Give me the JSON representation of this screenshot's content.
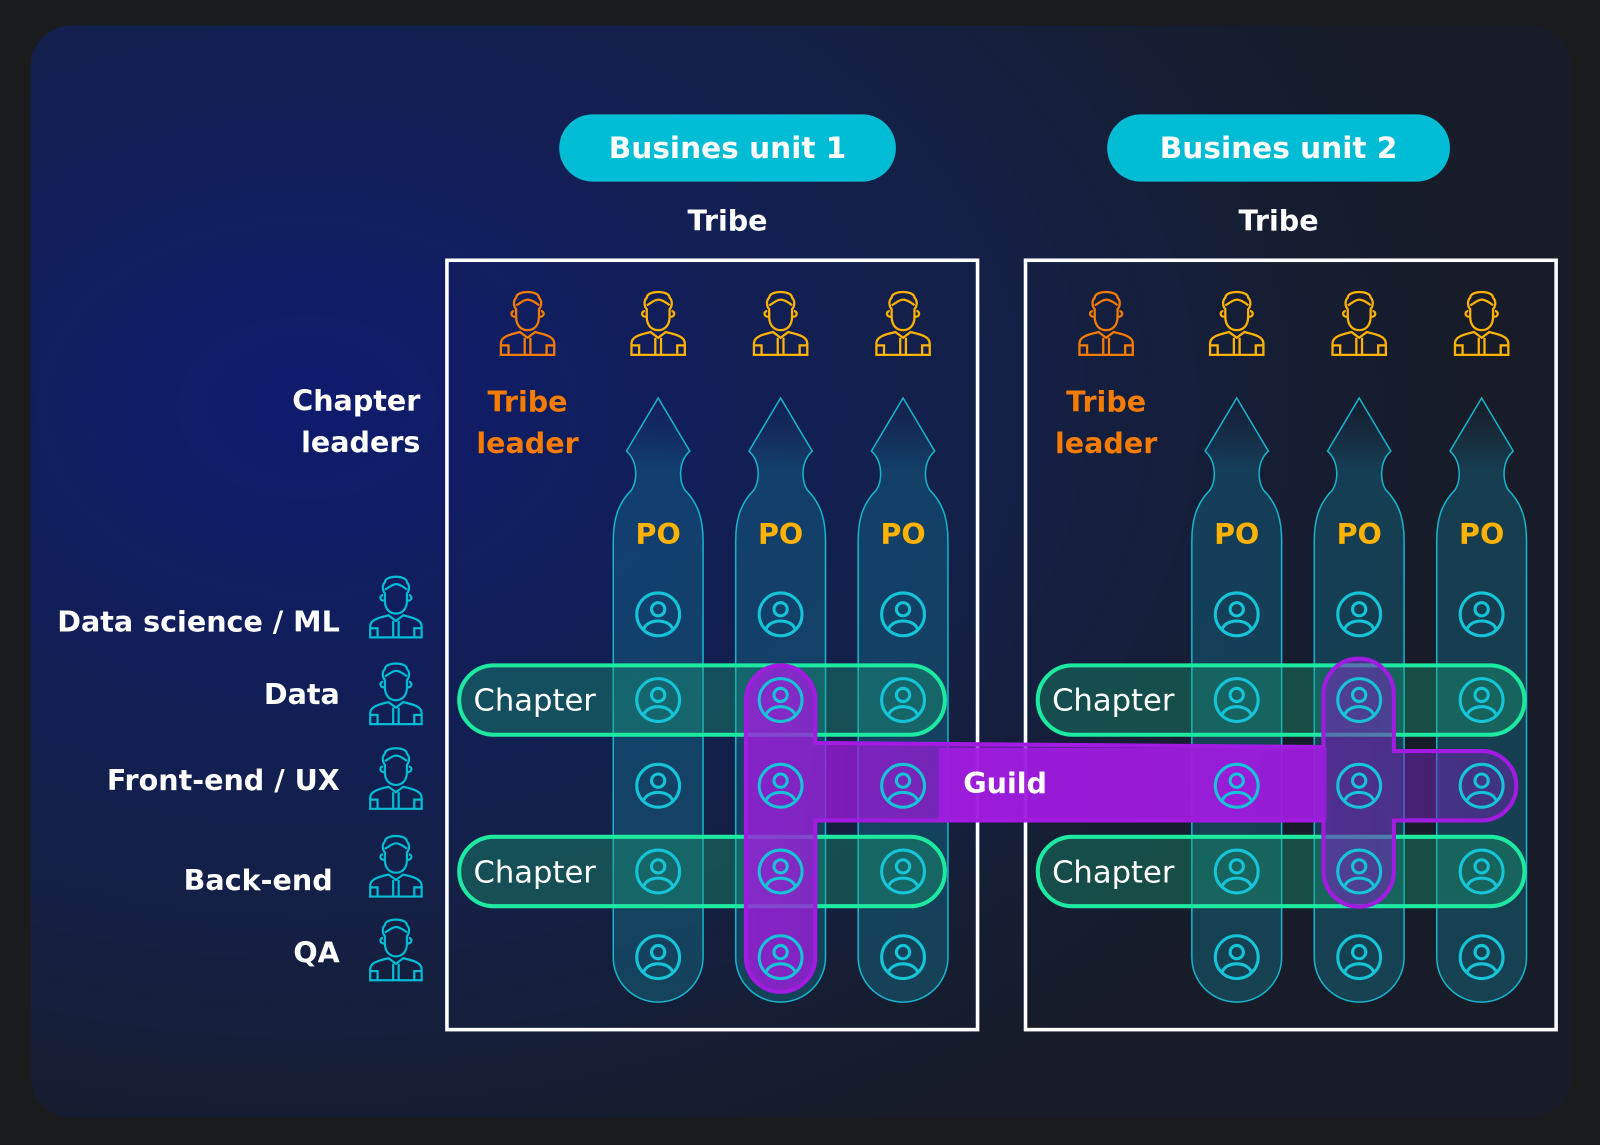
{
  "colors": {
    "background": "#1a1b1d",
    "background_glow": "#0f1a5c",
    "accent_cyan": "#00bcd4",
    "tribe_leader_orange": "#f57c00",
    "po_yellow": "#ffb300",
    "chapter_green": "#1de9a0",
    "guild_purple": "#a020e0",
    "box_border": "#ffffff"
  },
  "business_units": [
    {
      "label": "Busines unit 1",
      "tribe_label": "Tribe",
      "tribe_leader_label_line1": "Tribe",
      "tribe_leader_label_line2": "leader",
      "po_labels": [
        "PO",
        "PO",
        "PO"
      ],
      "chapter_labels": [
        "Chapter",
        "Chapter"
      ]
    },
    {
      "label": "Busines unit 2",
      "tribe_label": "Tribe",
      "tribe_leader_label_line1": "Tribe",
      "tribe_leader_label_line2": "leader",
      "po_labels": [
        "PO",
        "PO",
        "PO"
      ],
      "chapter_labels": [
        "Chapter",
        "Chapter"
      ]
    }
  ],
  "chapter_leaders": {
    "line1": "Chapter",
    "line2": "leaders"
  },
  "roles": [
    {
      "label": "Data science / ML",
      "icon": "man-shirt-icon"
    },
    {
      "label": "Data",
      "icon": "woman-icon"
    },
    {
      "label": "Front-end / UX",
      "icon": "man-icon"
    },
    {
      "label": "Back-end",
      "icon": "man-hoodie-icon"
    },
    {
      "label": "QA",
      "icon": "man-icon"
    }
  ],
  "guild": {
    "label": "Guild"
  }
}
